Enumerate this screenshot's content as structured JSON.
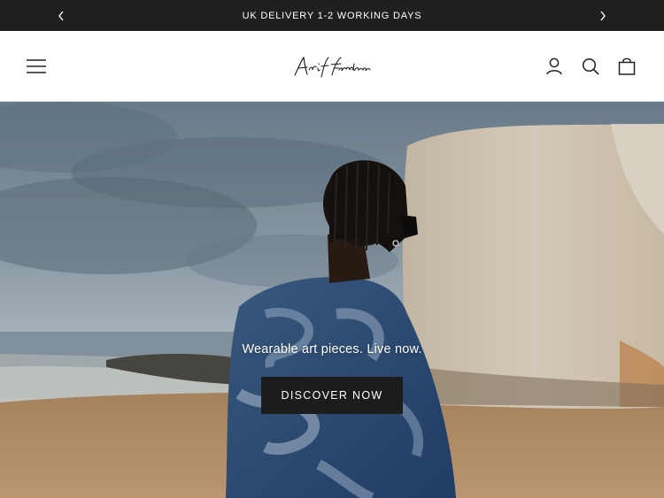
{
  "announcement": {
    "text": "UK DELIVERY 1-2 WORKING DAYS",
    "prev_icon": "chevron-left-icon",
    "next_icon": "chevron-right-icon"
  },
  "header": {
    "logo_text": "Arif Ferdous",
    "menu_icon": "hamburger-menu-icon",
    "icons": [
      "account-icon",
      "search-icon",
      "cart-icon"
    ]
  },
  "hero": {
    "tagline": "Wearable art pieces. Live now.",
    "cta_label": "DISCOVER NOW"
  },
  "colors": {
    "announcement_bg": "#1f1f1f",
    "header_bg": "#ffffff",
    "button_bg": "#1c1c1c",
    "text_light": "#ffffff"
  }
}
